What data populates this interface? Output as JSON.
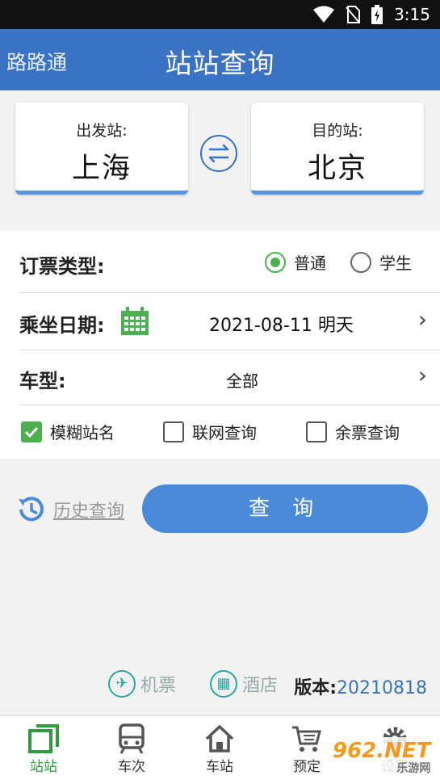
{
  "status": {
    "time": "3:15"
  },
  "header": {
    "app_name": "路路通",
    "title": "站站查询"
  },
  "stations": {
    "from_label": "出发站:",
    "from_value": "上海",
    "to_label": "目的站:",
    "to_value": "北京"
  },
  "form": {
    "ticket_type_label": "订票类型:",
    "ticket_type_options": [
      "普通",
      "学生"
    ],
    "ticket_type_selected": "普通",
    "date_label": "乘坐日期:",
    "date_value": "2021-08-11 明天",
    "train_type_label": "车型:",
    "train_type_value": "全部",
    "checks": [
      {
        "label": "模糊站名",
        "checked": true
      },
      {
        "label": "联网查询",
        "checked": false
      },
      {
        "label": "余票查询",
        "checked": false
      }
    ]
  },
  "actions": {
    "history_label": "历史查询",
    "query_label": "查 询"
  },
  "links": {
    "flight_label": "机票",
    "hotel_label": "酒店",
    "version_label": "版本:",
    "version_value": "20210818"
  },
  "tabs": [
    {
      "label": "站站",
      "icon": "station-icon",
      "active": true
    },
    {
      "label": "车次",
      "icon": "train-icon",
      "active": false
    },
    {
      "label": "车站",
      "icon": "home-icon",
      "active": false
    },
    {
      "label": "预定",
      "icon": "cart-icon",
      "active": false
    },
    {
      "label": "设置",
      "icon": "gear-icon",
      "active": false
    }
  ],
  "watermark": {
    "text": "962.NET 乐游网"
  },
  "colors": {
    "header": "#3b73c4",
    "accent_green": "#4caf50",
    "query_button": "#4a8ad8"
  }
}
